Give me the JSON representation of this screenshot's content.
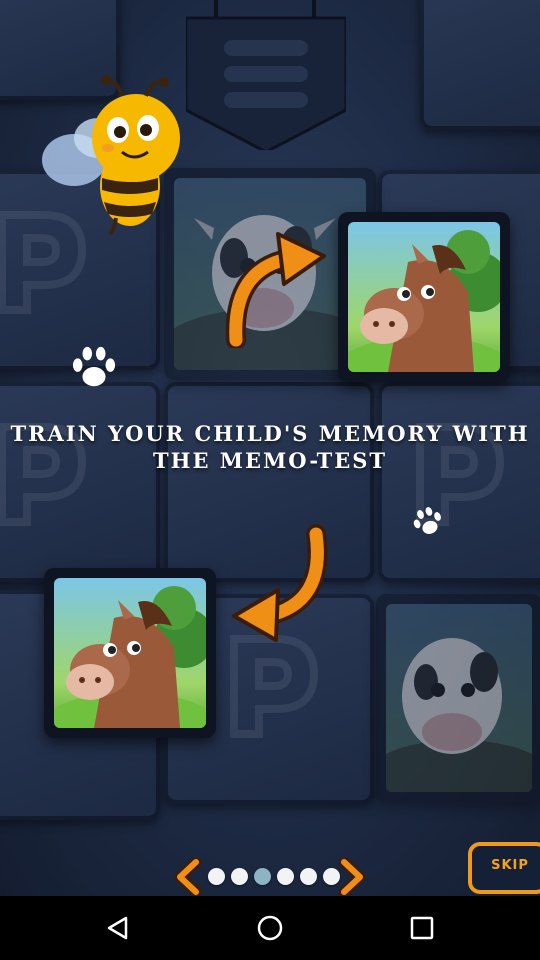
{
  "tutorial": {
    "headline_line1": "TRAIN YOUR CHILD'S MEMORY WITH",
    "headline_line2": "THE MEMO-TEST",
    "pager": {
      "total_pages": 6,
      "current_page": 3
    },
    "skip_label": "SKIP"
  },
  "cards": {
    "revealed": [
      "horse",
      "horse"
    ],
    "hidden_animal": "cow"
  },
  "system_nav": {
    "back": "back-icon",
    "home": "home-icon",
    "recents": "recents-icon"
  },
  "colors": {
    "accent_orange": "#f09a1a",
    "pager_active": "#8db3c4",
    "background": "#1e2b45"
  }
}
